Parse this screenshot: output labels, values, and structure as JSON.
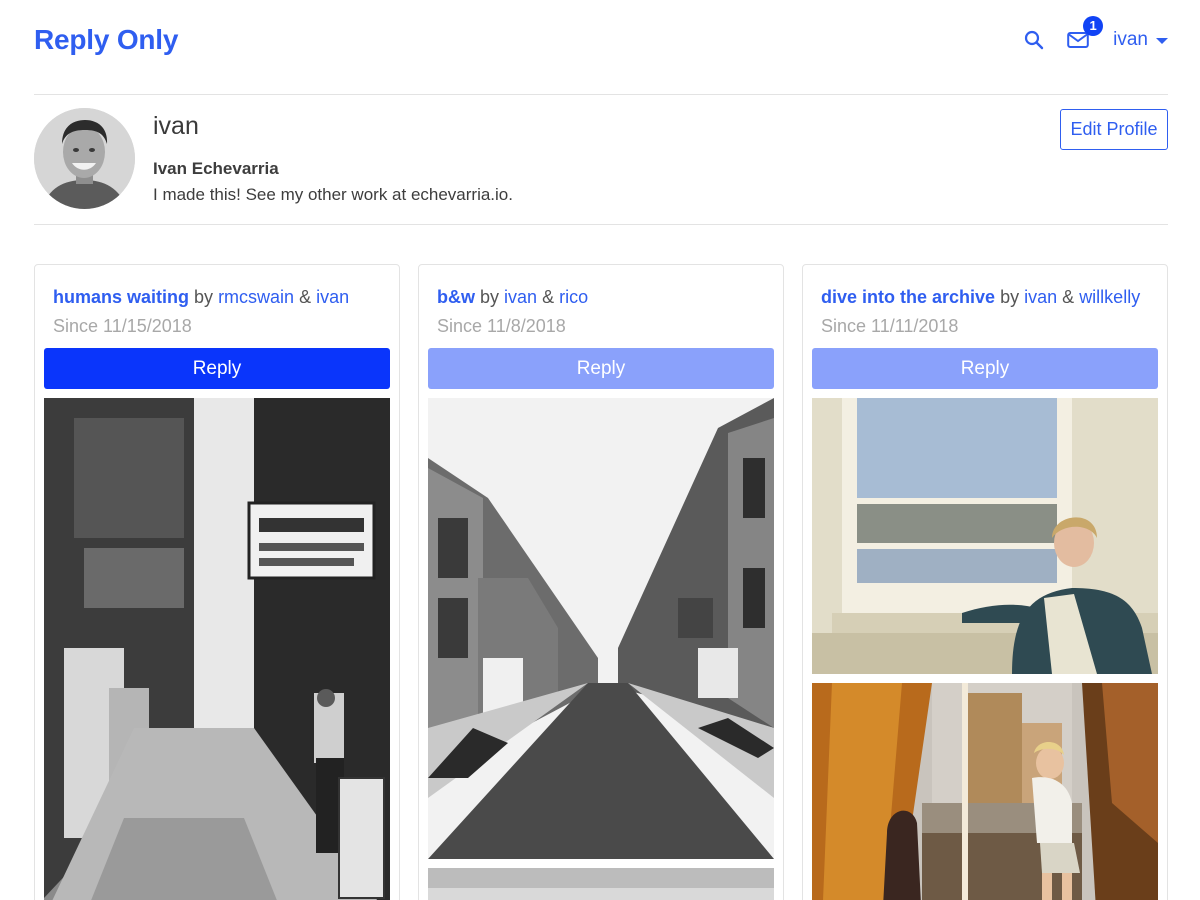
{
  "app": {
    "brand": "Reply Only"
  },
  "nav": {
    "search_icon": "search-icon",
    "mail_icon": "mail-icon",
    "mail_badge": "1",
    "user": "ivan"
  },
  "profile": {
    "username": "ivan",
    "full_name": "Ivan Echevarria",
    "bio": "I made this! See my other work at echevarria.io.",
    "edit_label": "Edit Profile"
  },
  "threads": [
    {
      "title": "humans waiting",
      "by": "by",
      "user1": "rmcswain",
      "amp": "&",
      "user2": "ivan",
      "since": "Since 11/15/2018",
      "reply": "Reply",
      "reply_active": true
    },
    {
      "title": "b&w",
      "by": "by",
      "user1": "ivan",
      "amp": "&",
      "user2": "rico",
      "since": "Since 11/8/2018",
      "reply": "Reply",
      "reply_active": false
    },
    {
      "title": "dive into the archive",
      "by": "by",
      "user1": "ivan",
      "amp": "&",
      "user2": "willkelly",
      "since": "Since 11/11/2018",
      "reply": "Reply",
      "reply_active": false
    }
  ],
  "colors": {
    "brand": "#2f5ef0",
    "reply_active": "#0a35fb",
    "reply_muted": "#8aa1fb",
    "since_text": "#a8a8a8",
    "divider": "#e3e3e3"
  }
}
